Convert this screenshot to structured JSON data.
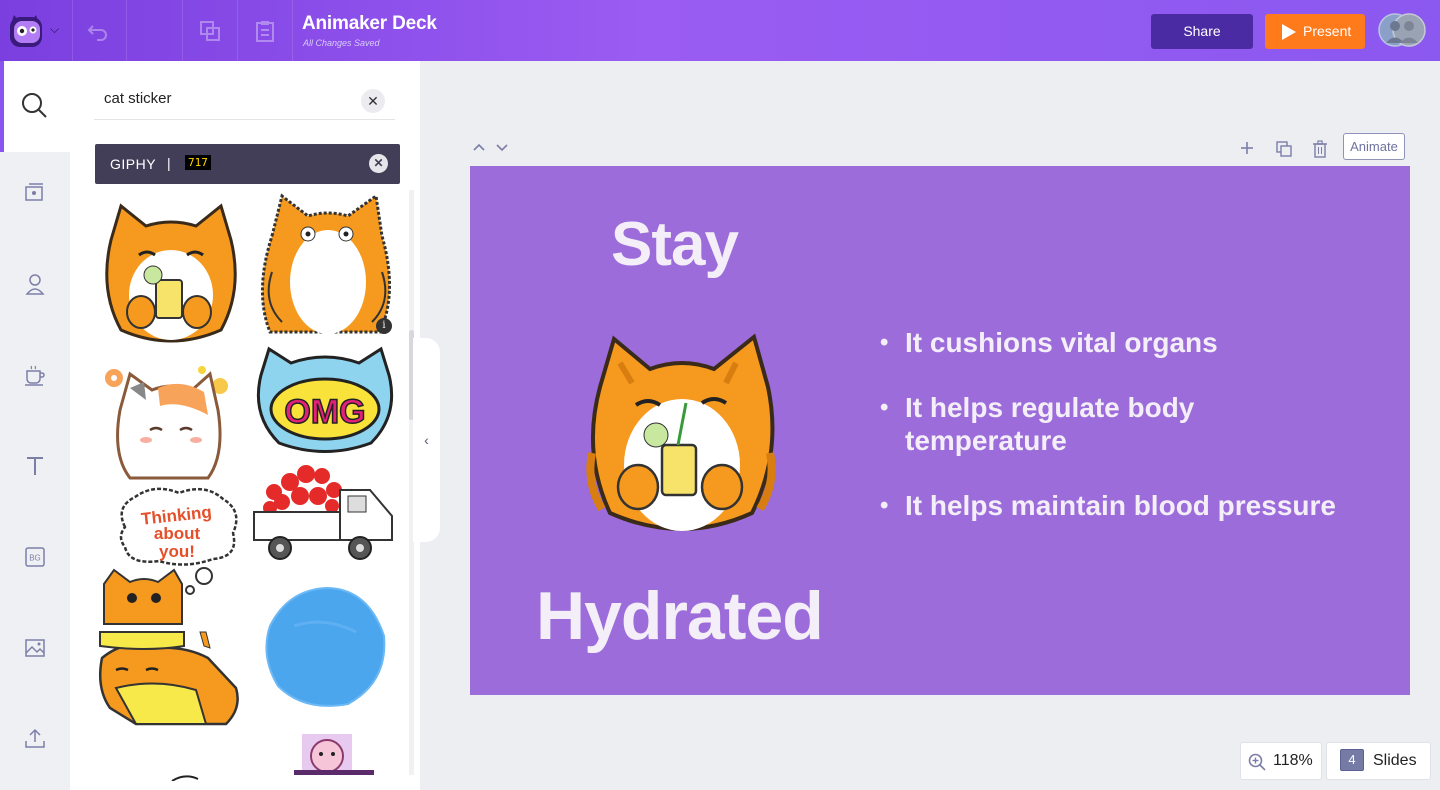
{
  "app": {
    "title": "Animaker Deck",
    "save_status": "All Changes Saved"
  },
  "toolbar": {
    "share_label": "Share",
    "present_label": "Present",
    "icons": [
      "undo-icon",
      "duplicate-icon",
      "paste-icon"
    ]
  },
  "sidebar": {
    "items": [
      {
        "name": "search",
        "icon": "search-icon",
        "active": true
      },
      {
        "name": "templates",
        "icon": "templates-icon"
      },
      {
        "name": "characters",
        "icon": "character-icon"
      },
      {
        "name": "props",
        "icon": "coffee-cup-icon"
      },
      {
        "name": "text",
        "icon": "text-icon"
      },
      {
        "name": "backgrounds",
        "icon": "bg-icon"
      },
      {
        "name": "images",
        "icon": "image-icon"
      },
      {
        "name": "upload",
        "icon": "upload-icon"
      }
    ]
  },
  "search": {
    "query": "cat sticker",
    "clear_icon": "close-icon"
  },
  "giphy": {
    "label": "GIPHY",
    "separator": "|",
    "count": "717"
  },
  "results": [
    {
      "name": "orange-cat-drinking"
    },
    {
      "name": "orange-cat-standing"
    },
    {
      "name": "calico-cat-flowers"
    },
    {
      "name": "omg-cat"
    },
    {
      "name": "thinking-about-you-cat",
      "text": "Thinking about you!"
    },
    {
      "name": "heart-truck"
    },
    {
      "name": "cat-lying-yellow"
    },
    {
      "name": "blue-circle"
    },
    {
      "name": "partial-sticker"
    }
  ],
  "omg_text": "OMG",
  "canvas": {
    "animate_label": "Animate"
  },
  "slide": {
    "color": "#9c6cdb",
    "title_top": "Stay",
    "title_bottom": "Hydrated",
    "bullets": [
      "It cushions vital organs",
      "It helps regulate body temperature",
      "It helps maintain blood pressure"
    ]
  },
  "footer": {
    "zoom": "118%",
    "slide_count": "4",
    "slides_label": "Slides"
  }
}
